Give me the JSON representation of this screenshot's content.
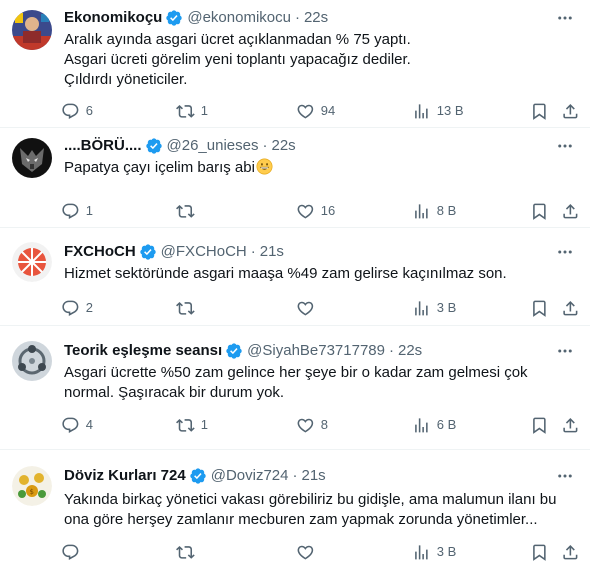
{
  "tweets": [
    {
      "name": "Ekonomikoçu",
      "handle": "@ekonomikocu",
      "time": "22s",
      "lines": [
        "Aralık ayında asgari ücret açıklanmadan % 75 yaptı.",
        "Asgari ücreti görelim yeni toplantı yapacağız dediler.",
        "Çıldırdı yöneticiler."
      ],
      "replies": "6",
      "retweets": "1",
      "likes": "94",
      "views": "13 B"
    },
    {
      "name": "....BÖRÜ....",
      "handle": "@26_unieses",
      "time": "22s",
      "lines": [
        "Papatya çayı içelim barış abi"
      ],
      "replies": "1",
      "retweets": "",
      "likes": "16",
      "views": "8 B"
    },
    {
      "name": "FXCHoCH",
      "handle": "@FXCHoCH",
      "time": "21s",
      "lines": [
        "Hizmet sektöründe asgari maaşa %49 zam gelirse kaçınılmaz son."
      ],
      "replies": "2",
      "retweets": "",
      "likes": "",
      "views": "3 B"
    },
    {
      "name": "Teorik eşleşme seansı",
      "handle": "@SiyahBe73717789",
      "time": "22s",
      "lines": [
        "Asgari ücrette %50 zam gelince her şeye bir o kadar zam gelmesi çok",
        "normal. Şaşıracak bir durum yok."
      ],
      "replies": "4",
      "retweets": "1",
      "likes": "8",
      "views": "6 B"
    },
    {
      "name": "Döviz Kurları 724",
      "handle": "@Doviz724",
      "time": "21s",
      "lines": [
        "Yakında birkaç yönetici vakası görebiliriz bu gidişle, ama malumun ilanı bu",
        "ona göre herşey zamlanır mecburen zam yapmak zorunda yönetimler..."
      ],
      "replies": "",
      "retweets": "",
      "likes": "",
      "views": "3 B"
    }
  ],
  "colors": {
    "verified": "#1d9bf0",
    "muted": "#536471",
    "text": "#0f1419",
    "divider": "#eff3f4"
  },
  "icons": [
    "verified-badge-icon",
    "more-icon",
    "reply-icon",
    "retweet-icon",
    "like-icon",
    "views-icon",
    "bookmark-icon",
    "share-icon",
    "grinning-emoji"
  ]
}
